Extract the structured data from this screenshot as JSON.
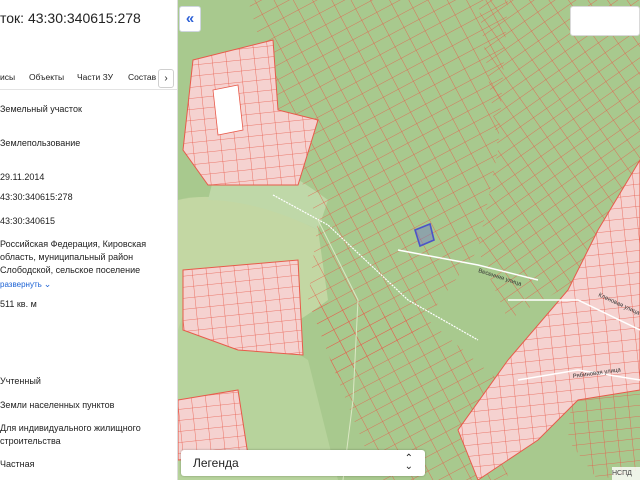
{
  "panel": {
    "title": "ток: 43:30:340615:278",
    "tabs": [
      "исы",
      "Объекты",
      "Части ЗУ",
      "Состав"
    ],
    "more_tab": "›",
    "rows": [
      "Земельный участок",
      "Землепользование",
      "29.11.2014",
      "43:30:340615:278",
      "43:30:340615",
      "Российская Федерация, Кировская",
      "область, муниципальный район",
      "Слободской, сельское поселение",
      "развернуть",
      "511 кв. м",
      "Учтенный",
      "Земли населенных пунктов",
      "Для индивидуального жилищного",
      "строительства",
      "Частная"
    ]
  },
  "map": {
    "collapse_label": "«",
    "legend_label": "Легенда",
    "legend_arrows": "⌃⌄",
    "copyright": "НСПД",
    "streets": [
      "Весенняя улица",
      "Кленовая улица",
      "Рябиновая улица"
    ],
    "colors": {
      "forest": "#a8c98e",
      "field": "#c3d7a3",
      "parcel_line": "#e85a4a",
      "settlement": "#f5d2d0",
      "selected_parcel": "#4b54c8"
    }
  }
}
